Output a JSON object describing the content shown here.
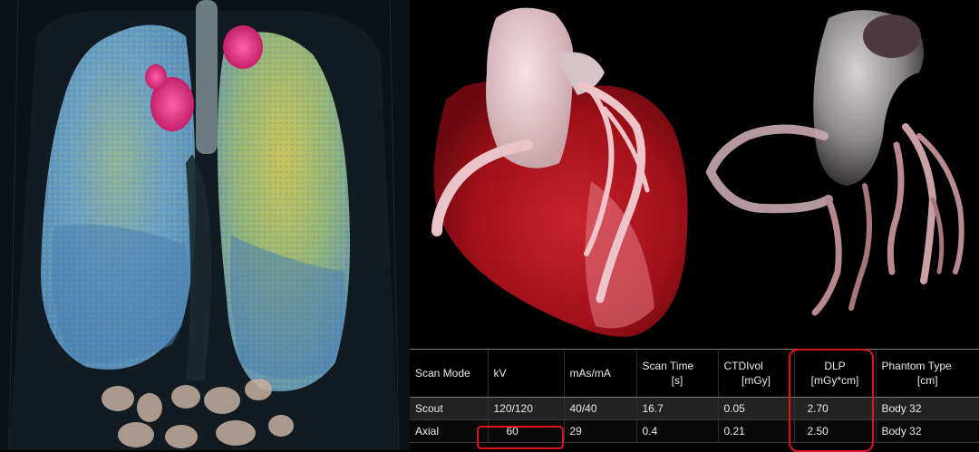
{
  "panels": {
    "lung": {
      "icon": "lung-volume-rendering"
    },
    "heart": {
      "icon": "heart-volume-rendering"
    },
    "coronary": {
      "icon": "coronary-tree-rendering"
    }
  },
  "dose_table": {
    "headers": [
      {
        "line1": "Scan Mode",
        "line2": ""
      },
      {
        "line1": "kV",
        "line2": ""
      },
      {
        "line1": "mAs/mA",
        "line2": ""
      },
      {
        "line1": "Scan Time",
        "line2": "[s]"
      },
      {
        "line1": "CTDIvol",
        "line2": "[mGy]"
      },
      {
        "line1": "DLP",
        "line2": "[mGy*cm]"
      },
      {
        "line1": "Phantom Type",
        "line2": "[cm]"
      }
    ],
    "rows": [
      [
        "Scout",
        "120/120",
        "40/40",
        "16.7",
        "0.05",
        "2.70",
        "Body 32"
      ],
      [
        "Axial",
        "60",
        "29",
        "0.4",
        "0.21",
        "2.50",
        "Body 32"
      ]
    ],
    "highlight_color": "#e0141e"
  },
  "colors": {
    "lung_blue": "#5f9cc6",
    "lung_yellow": "#c9c24e",
    "lung_magenta": "#e0388a",
    "heart_red": "#b1121c",
    "aorta_pink": "#e9c9cf"
  }
}
